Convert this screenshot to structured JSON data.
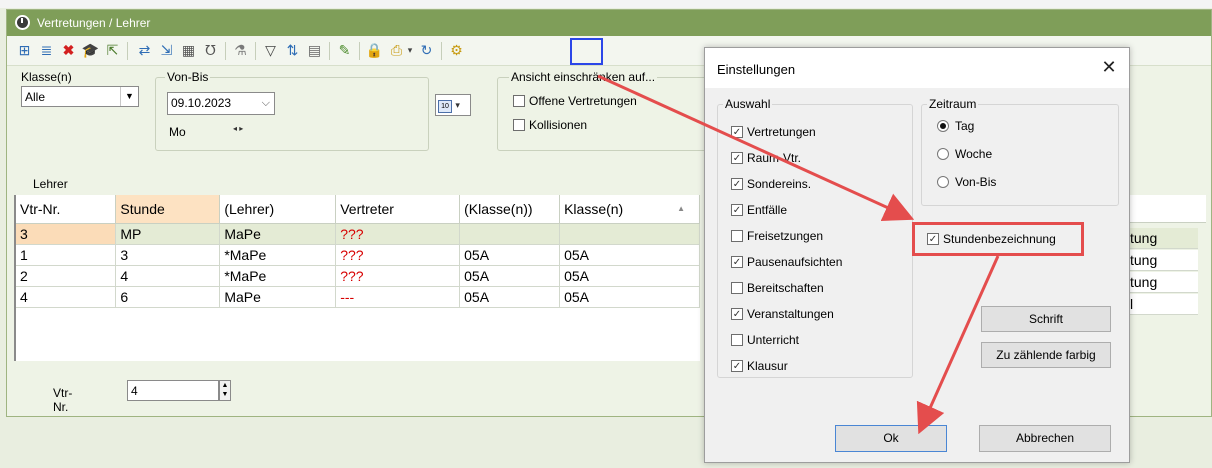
{
  "window": {
    "title": "Vertretungen / Lehrer"
  },
  "toolbar": {
    "icons": [
      "grid-icon",
      "list-icon",
      "delete-icon",
      "teacher-icon",
      "import-icon",
      "transfer-icon",
      "export-icon",
      "calculator-icon",
      "stethoscope-icon",
      "wand-icon",
      "filter-icon",
      "sort-icon",
      "table-icon",
      "check-pen-icon",
      "lock-icon",
      "print-icon",
      "dropdown-icon",
      "refresh-icon",
      "settings-icon"
    ]
  },
  "filter": {
    "klasse_label": "Klasse(n)",
    "klasse_value": "Alle",
    "vonbis_label": "Von-Bis",
    "date_value": "09.10.2023",
    "weekday": "Mo",
    "ansicht_label": "Ansicht einschränken auf...",
    "offene_label": "Offene Vertretungen",
    "kollisionen_label": "Kollisionen",
    "lehrer_label": "Lehrer"
  },
  "table": {
    "headers": [
      "Vtr-Nr.",
      "Stunde",
      "(Lehrer)",
      "Vertreter",
      "(Klasse(n))",
      "Klasse(n)"
    ],
    "rows": [
      [
        "3",
        "MP",
        "MaPe",
        "???",
        "",
        ""
      ],
      [
        "1",
        "3",
        "*MaPe",
        "???",
        "05A",
        "05A"
      ],
      [
        "2",
        "4",
        "*MaPe",
        "???",
        "05A",
        "05A"
      ],
      [
        "4",
        "6",
        "MaPe",
        "---",
        "05A",
        "05A"
      ]
    ],
    "right_cells": [
      "tung",
      "tung",
      "tung",
      "l"
    ]
  },
  "bottom": {
    "vtr_label": "Vtr-Nr.",
    "vtr_value": "4"
  },
  "dialog": {
    "title": "Einstellungen",
    "close": "✕",
    "auswahl_label": "Auswahl",
    "auswahl_items": [
      {
        "label": "Vertretungen",
        "checked": true
      },
      {
        "label": "Raum-Vtr.",
        "checked": true
      },
      {
        "label": "Sondereins.",
        "checked": true
      },
      {
        "label": "Entfälle",
        "checked": true
      },
      {
        "label": "Freisetzungen",
        "checked": false
      },
      {
        "label": "Pausenaufsichten",
        "checked": true
      },
      {
        "label": "Bereitschaften",
        "checked": false
      },
      {
        "label": "Veranstaltungen",
        "checked": true
      },
      {
        "label": "Unterricht",
        "checked": false
      },
      {
        "label": "Klausur",
        "checked": true
      }
    ],
    "zeitraum_label": "Zeitraum",
    "zeitraum_options": [
      "Tag",
      "Woche",
      "Von-Bis"
    ],
    "zeitraum_selected": "Tag",
    "stundenbezeichnung_label": "Stundenbezeichnung",
    "schrift_button": "Schrift",
    "farbig_button": "Zu zählende farbig",
    "ok_button": "Ok",
    "cancel_button": "Abbrechen"
  },
  "colors": {
    "titlebar": "#7f9e59",
    "highlight_blue": "#2b46e8",
    "annotation_red": "#e44d4d",
    "missing_red": "#d70000",
    "selected_row": "#e4ebd5"
  }
}
